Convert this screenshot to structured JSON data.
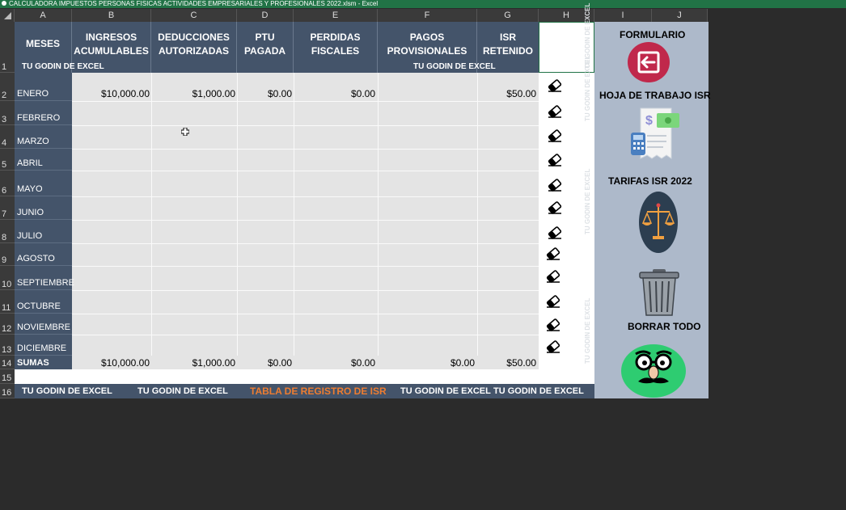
{
  "window_title": "CALCULADORA IMPUESTOS PERSONAS FISICAS ACTIVIDADES EMPRESARIALES Y PROFESIONALES 2022.xlsm - Excel",
  "columns": [
    "A",
    "B",
    "C",
    "D",
    "E",
    "F",
    "G",
    "H",
    "I",
    "J"
  ],
  "row_numbers": [
    "1",
    "2",
    "3",
    "4",
    "5",
    "6",
    "7",
    "8",
    "9",
    "10",
    "11",
    "12",
    "13",
    "14",
    "15",
    "16"
  ],
  "headers": {
    "meses": "MESES",
    "ingresos": [
      "INGRESOS",
      "ACUMULABLES"
    ],
    "deducciones": [
      "DEDUCCIONES",
      "AUTORIZADAS"
    ],
    "ptu": [
      "PTU",
      "PAGADA"
    ],
    "perdidas": [
      "PERDIDAS",
      "FISCALES"
    ],
    "pagos": [
      "PAGOS",
      "PROVISIONALES"
    ],
    "isr": [
      "ISR",
      "RETENIDO"
    ]
  },
  "watermark": "TU GODIN DE EXCEL",
  "months": [
    "ENERO",
    "FEBRERO",
    "MARZO",
    "ABRIL",
    "MAYO",
    "JUNIO",
    "JULIO",
    "AGOSTO",
    "SEPTIEMBRE",
    "OCTUBRE",
    "NOVIEMBRE",
    "DICIEMBRE"
  ],
  "enero_values": {
    "ingresos": "$10,000.00",
    "deducciones": "$1,000.00",
    "ptu": "$0.00",
    "perdidas": "$0.00",
    "isr": "$50.00"
  },
  "sumas": {
    "label": "SUMAS",
    "ingresos": "$10,000.00",
    "deducciones": "$1,000.00",
    "ptu": "$0.00",
    "perdidas": "$0.00",
    "pagos": "$0.00",
    "isr": "$50.00"
  },
  "footer": {
    "left1": "TU GODIN DE EXCEL",
    "left2": "TU GODIN DE EXCEL",
    "center": "TABLA DE REGISTRO DE ISR",
    "right1": "TU GODIN DE EXCEL",
    "right2": "TU GODIN DE EXCEL"
  },
  "panel": {
    "formulario": "FORMULARIO",
    "hoja": "HOJA DE TRABAJO ISR",
    "tarifas": "TARIFAS ISR 2022",
    "borrar": "BORRAR TODO"
  },
  "colors": {
    "header": "#44546a",
    "panel": "#adb9ca",
    "excel_green": "#217346",
    "footer_accent": "#ed7d31",
    "logo_green": "#2ecc71",
    "formulario_red": "#c0284b",
    "scale_bg": "#2c3e50"
  },
  "icons": [
    "eraser-icon",
    "back-arrow-icon",
    "invoice-icon",
    "scale-icon",
    "trash-icon",
    "mascot-logo-icon"
  ]
}
